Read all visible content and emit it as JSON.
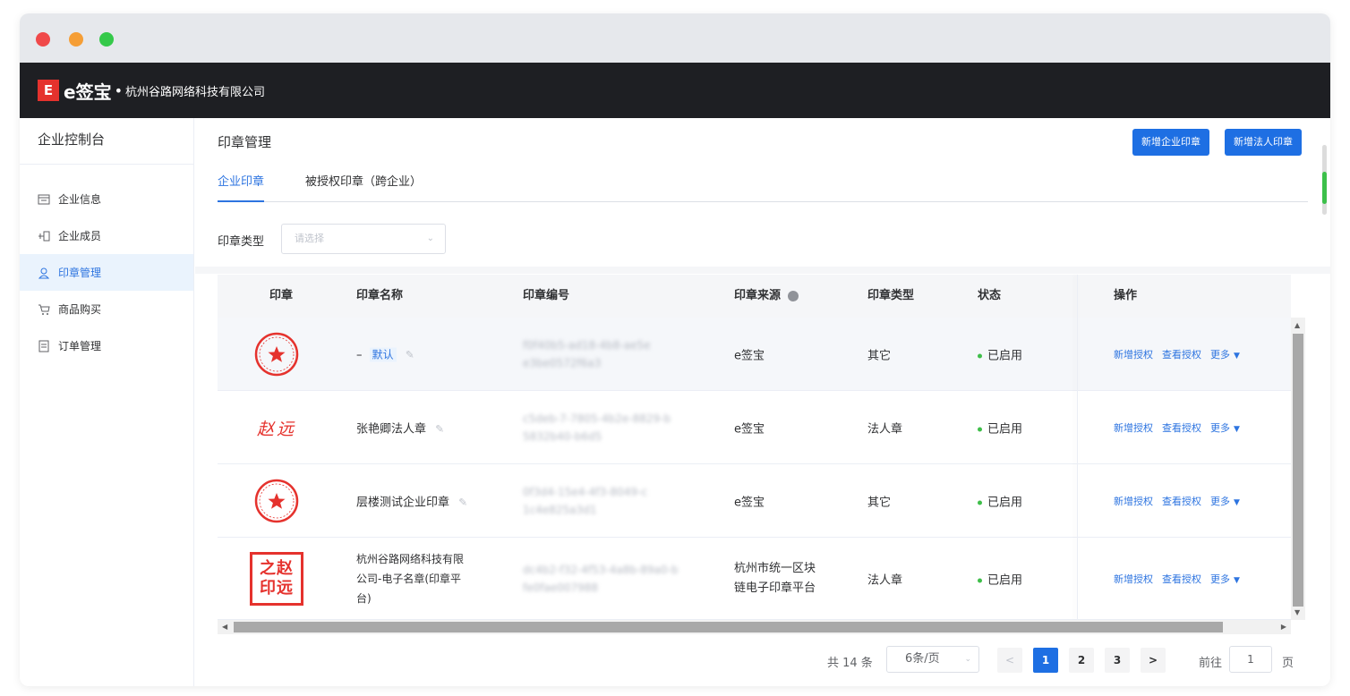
{
  "header": {
    "brand": "e签宝",
    "company": "杭州谷路网络科技有限公司",
    "logo_glyph": "E"
  },
  "sidebar": {
    "title": "企业控制台",
    "items": [
      {
        "label": "企业信息",
        "icon": "building-icon"
      },
      {
        "label": "企业成员",
        "icon": "org-icon"
      },
      {
        "label": "印章管理",
        "icon": "user-seal-icon",
        "active": true
      },
      {
        "label": "商品购买",
        "icon": "cart-icon"
      },
      {
        "label": "订单管理",
        "icon": "order-icon"
      }
    ]
  },
  "main": {
    "title": "印章管理",
    "buttons": {
      "add_company": "新增企业印章",
      "add_legal": "新增法人印章"
    },
    "tabs": [
      {
        "label": "企业印章",
        "active": true
      },
      {
        "label": "被授权印章（跨企业）",
        "active": false
      }
    ],
    "filter": {
      "label": "印章类型",
      "placeholder": "请选择"
    }
  },
  "table": {
    "columns": [
      "印章",
      "印章名称",
      "印章编号",
      "印章来源",
      "印章类型",
      "状态",
      "操作"
    ],
    "rows": [
      {
        "seal": "round",
        "name": "–",
        "default_tag": "默认",
        "code_line1": "f0f40b5-ad18-4b8-ae5e",
        "code_line2": "e3be0572f6a3",
        "source": "e签宝",
        "type": "其它",
        "status": "已启用"
      },
      {
        "seal": "text",
        "seal_text": "赵远",
        "name": "张艳卿法人章",
        "code_line1": "c5deb-7-7805-4b2e-8829-b",
        "code_line2": "5832b40-b6d5",
        "source": "e签宝",
        "type": "法人章",
        "status": "已启用"
      },
      {
        "seal": "round",
        "name": "层楼测试企业印章",
        "code_line1": "0f3d4-15e4-4f3-8049-c",
        "code_line2": "1c4e825a3d1",
        "source": "e签宝",
        "type": "其它",
        "status": "已启用"
      },
      {
        "seal": "square",
        "seal_text_a": "之赵",
        "seal_text_b": "印远",
        "name_line1": "杭州谷路网络科技有限",
        "name_line2": "公司-电子名章(印章平",
        "name_line3": "台)",
        "code_line1": "dc4b2-f32-4f53-4a8b-89a0-b",
        "code_line2": "fe0fae007988",
        "source_line1": "杭州市统一区块",
        "source_line2": "链电子印章平台",
        "type": "法人章",
        "status": "已启用"
      }
    ],
    "ops": {
      "add_auth": "新增授权",
      "view_auth": "查看授权",
      "more": "更多"
    }
  },
  "pager": {
    "total": "共 14 条",
    "page_size": "6条/页",
    "pages": [
      "1",
      "2",
      "3"
    ],
    "current": "1",
    "prev": "<",
    "next": ">",
    "goto_label": "前往",
    "goto_value": "1",
    "unit": "页"
  },
  "colors": {
    "primary": "#1e6fe3",
    "seal_red": "#e5322d",
    "topbar": "#1e1f23",
    "status_green": "#3fbe4a"
  }
}
